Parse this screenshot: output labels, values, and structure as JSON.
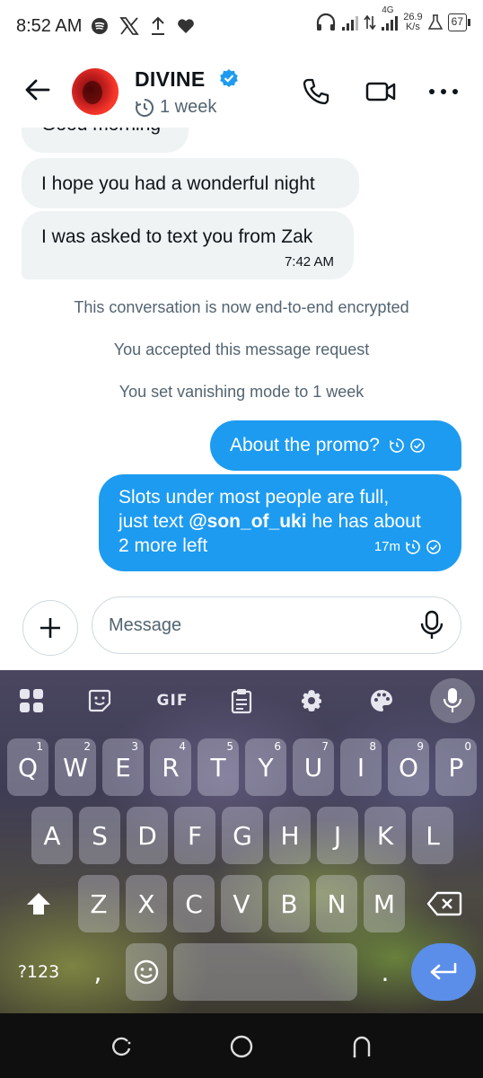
{
  "status_bar": {
    "time": "8:52 AM",
    "network_type": "4G",
    "speed_value": "26.9",
    "speed_unit": "K/s",
    "battery": "67"
  },
  "header": {
    "contact_name": "DIVINE",
    "vanish_duration": "1 week",
    "verified_color": "#1d9bf0"
  },
  "messages": {
    "incoming_partial": "Good morning",
    "incoming_1": "I hope you had a wonderful night",
    "incoming_2": "I was asked to text you from Zak",
    "incoming_2_time": "7:42 AM",
    "system_1": "This conversation is now end-to-end encrypted",
    "system_2": "You accepted this message request",
    "system_3": "You set vanishing mode to 1 week",
    "outgoing_1": "About the promo?",
    "outgoing_2_line1": "Slots under most people are full,",
    "outgoing_2_line2_prefix": "just text ",
    "outgoing_2_mention": "@son_of_uki",
    "outgoing_2_line2_suffix": " he has about",
    "outgoing_2_line3": "2 more left",
    "outgoing_2_time": "17m"
  },
  "composer": {
    "placeholder": "Message"
  },
  "keyboard": {
    "toolbar": {
      "gif": "GIF"
    },
    "row1": [
      {
        "key": "Q",
        "hint": "1"
      },
      {
        "key": "W",
        "hint": "2"
      },
      {
        "key": "E",
        "hint": "3"
      },
      {
        "key": "R",
        "hint": "4"
      },
      {
        "key": "T",
        "hint": "5"
      },
      {
        "key": "Y",
        "hint": "6"
      },
      {
        "key": "U",
        "hint": "7"
      },
      {
        "key": "I",
        "hint": "8"
      },
      {
        "key": "O",
        "hint": "9"
      },
      {
        "key": "P",
        "hint": "0"
      }
    ],
    "row2": [
      "A",
      "S",
      "D",
      "F",
      "G",
      "H",
      "J",
      "K",
      "L"
    ],
    "row3": [
      "Z",
      "X",
      "C",
      "V",
      "B",
      "N",
      "M"
    ],
    "symbols_key": "?123",
    "comma_key": ",",
    "period_key": "."
  },
  "colors": {
    "accent": "#1d9bf0",
    "incoming_bubble": "#eff3f4",
    "secondary_text": "#536471",
    "enter_key": "#5b8ee8"
  },
  "icons": {
    "back": "arrow-left-icon",
    "call": "phone-icon",
    "video": "video-camera-icon",
    "more": "more-dots-icon",
    "timer": "timer-icon",
    "add": "plus-icon",
    "mic": "microphone-icon"
  }
}
